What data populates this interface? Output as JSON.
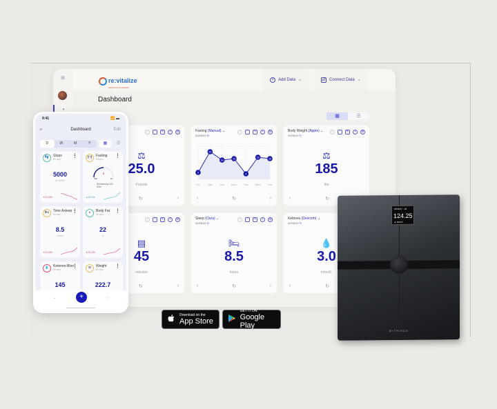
{
  "app": {
    "logo_text": "re:vitalize",
    "logo_tagline": "weight loss & wellness",
    "page_title": "Dashboard",
    "topbar": {
      "add_data_label": "Add Data",
      "connect_data_label": "Connect Data"
    },
    "view_toggle": {
      "grid_icon": "▦",
      "list_icon": "☰"
    },
    "sidebar": {
      "menu_icon": "≡",
      "dashboard_icon": "◔"
    },
    "cards": [
      {
        "title": "",
        "source": "",
        "date": "",
        "icon": "⚖",
        "value": "25.0",
        "unit": "Pounds",
        "type": "stat"
      },
      {
        "title": "Fasting",
        "source": "(Manual)",
        "date": "02/05/19",
        "type": "chart"
      },
      {
        "title": "Body Weight",
        "source": "(Apple)",
        "date": "02/05/19",
        "icon": "⚖",
        "value": "185",
        "unit": "lbs",
        "type": "stat"
      },
      {
        "title": "",
        "source": "",
        "date": "",
        "icon": "▤",
        "value": "45",
        "unit": "minutes",
        "type": "stat"
      },
      {
        "title": "Sleep",
        "source": "(Oura)",
        "date": "02/05/19",
        "icon": "🛏",
        "value": "8.5",
        "unit": "hours",
        "type": "stat"
      },
      {
        "title": "Ketones",
        "source": "(Dexcom)",
        "date": "02/05/19",
        "icon": "💧",
        "value": "3.0",
        "unit": "mmol/L",
        "type": "stat"
      }
    ]
  },
  "chart_data": {
    "type": "line",
    "title": "Fasting (Manual)",
    "categories": [
      "Fri",
      "Sat",
      "Sun",
      "Mon",
      "Tue",
      "Wed",
      "Thu"
    ],
    "values": [
      5,
      20,
      14,
      15,
      4,
      16,
      15
    ],
    "xlabel": "",
    "ylabel": "",
    "ylim": [
      0,
      24
    ],
    "grid": true
  },
  "phone": {
    "time": "9:41",
    "signal": "📶 ▬",
    "title": "Dashboard",
    "edit_label": "Edit",
    "segments": [
      "D",
      "W",
      "M",
      "Y"
    ],
    "active_segment": "D",
    "cards": [
      {
        "name": "Steps",
        "ago": "9h ago",
        "value": "5000",
        "sub": "of 10000",
        "pct": "▾ 12.3%",
        "pct_color": "#d03060",
        "ring_color": "#5ac0a0",
        "icon": "👣"
      },
      {
        "name": "Fasting",
        "ago": "9h ago",
        "value": "",
        "sub": "Remaining 10h 32m",
        "pct": "▴ 10.2%",
        "pct_color": "#30a0b0",
        "ring_color": "#e8c060",
        "icon": "🍽",
        "gauge_left": "15h",
        "gauge_right": "0s"
      },
      {
        "name": "Time Asleep",
        "ago": "5h ago",
        "value": "8.5",
        "sub": "Hours",
        "pct": "▾ 12.3%",
        "pct_color": "#d03060",
        "ring_color": "#e8c060",
        "icon": "🛏"
      },
      {
        "name": "Body Fat",
        "ago": "5h ago",
        "value": "22",
        "sub": "%",
        "pct": "▾ 12.3%",
        "pct_color": "#d03060",
        "ring_color": "#5ac0a0",
        "icon": "◒"
      },
      {
        "name": "Ketones-Blood",
        "ago": "5h ago",
        "value": "145",
        "sub": "",
        "ring_color": "#e05070",
        "icon": "💧"
      },
      {
        "name": "Weight",
        "ago": "5h ago",
        "value": "222.7",
        "sub": "",
        "ring_color": "#e8c060",
        "icon": "⚖"
      }
    ],
    "fab_label": "+"
  },
  "scale": {
    "screen_label": "WEIGHT · LB",
    "screen_value": "124.25",
    "screen_footer": "▲ NAUIY",
    "brand": "WITHINGS"
  },
  "stores": {
    "apple_small": "Download on the",
    "apple_big": "App Store",
    "google_small": "GET IT ON",
    "google_big": "Google Play"
  }
}
